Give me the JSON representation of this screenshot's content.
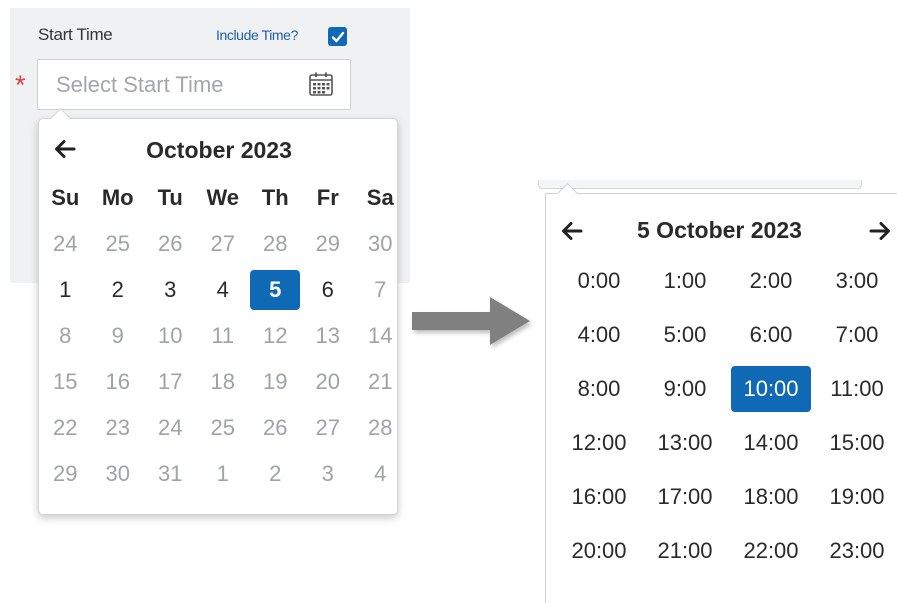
{
  "form": {
    "label": "Start Time",
    "include_time_label": "Include Time?",
    "include_time_checked": true,
    "required_mark": "*",
    "placeholder": "Select Start Time"
  },
  "datepicker": {
    "title": "October 2023",
    "weekdays": [
      "Su",
      "Mo",
      "Tu",
      "We",
      "Th",
      "Fr",
      "Sa"
    ],
    "days": [
      {
        "d": "24",
        "cur": false
      },
      {
        "d": "25",
        "cur": false
      },
      {
        "d": "26",
        "cur": false
      },
      {
        "d": "27",
        "cur": false
      },
      {
        "d": "28",
        "cur": false
      },
      {
        "d": "29",
        "cur": false
      },
      {
        "d": "30",
        "cur": false
      },
      {
        "d": "1",
        "cur": true
      },
      {
        "d": "2",
        "cur": true
      },
      {
        "d": "3",
        "cur": true
      },
      {
        "d": "4",
        "cur": true
      },
      {
        "d": "5",
        "cur": true,
        "selected": true
      },
      {
        "d": "6",
        "cur": true
      },
      {
        "d": "7",
        "cur": false
      },
      {
        "d": "8",
        "cur": false
      },
      {
        "d": "9",
        "cur": false
      },
      {
        "d": "10",
        "cur": false
      },
      {
        "d": "11",
        "cur": false
      },
      {
        "d": "12",
        "cur": false
      },
      {
        "d": "13",
        "cur": false
      },
      {
        "d": "14",
        "cur": false
      },
      {
        "d": "15",
        "cur": false
      },
      {
        "d": "16",
        "cur": false
      },
      {
        "d": "17",
        "cur": false
      },
      {
        "d": "18",
        "cur": false
      },
      {
        "d": "19",
        "cur": false
      },
      {
        "d": "20",
        "cur": false
      },
      {
        "d": "21",
        "cur": false
      },
      {
        "d": "22",
        "cur": false
      },
      {
        "d": "23",
        "cur": false
      },
      {
        "d": "24",
        "cur": false
      },
      {
        "d": "25",
        "cur": false
      },
      {
        "d": "26",
        "cur": false
      },
      {
        "d": "27",
        "cur": false
      },
      {
        "d": "28",
        "cur": false
      },
      {
        "d": "29",
        "cur": false
      },
      {
        "d": "30",
        "cur": false
      },
      {
        "d": "31",
        "cur": false
      },
      {
        "d": "1",
        "cur": false
      },
      {
        "d": "2",
        "cur": false
      },
      {
        "d": "3",
        "cur": false
      },
      {
        "d": "4",
        "cur": false
      }
    ]
  },
  "timepicker": {
    "title": "5 October 2023",
    "hours": [
      "0:00",
      "1:00",
      "2:00",
      "3:00",
      "4:00",
      "5:00",
      "6:00",
      "7:00",
      "8:00",
      "9:00",
      "10:00",
      "11:00",
      "12:00",
      "13:00",
      "14:00",
      "15:00",
      "16:00",
      "17:00",
      "18:00",
      "19:00",
      "20:00",
      "21:00",
      "22:00",
      "23:00"
    ],
    "selected": "10:00"
  },
  "icons": {
    "prev": "arrow-left-icon",
    "next": "arrow-right-icon",
    "calendar": "calendar-icon",
    "check": "checkmark-icon",
    "transition": "big-arrow-right-icon"
  },
  "colors": {
    "accent": "#0f69b4",
    "required": "#e2403a",
    "link": "#1c5fa8",
    "muted_day": "#9fa3a8",
    "panel_bg": "#f0f1f3"
  }
}
